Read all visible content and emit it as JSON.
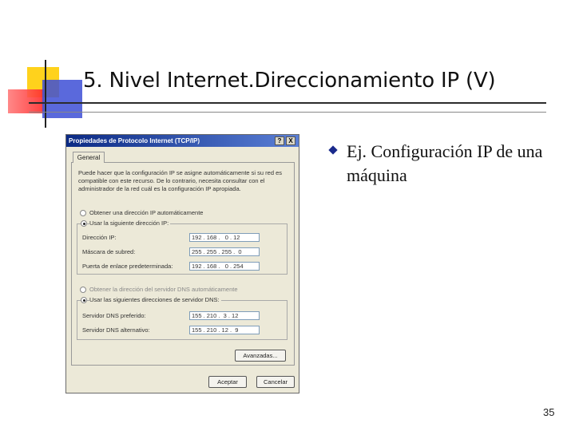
{
  "slide": {
    "title": "5. Nivel Internet.Direccionamiento IP (V)",
    "bullet": "Ej. Configuración IP de una máquina",
    "page_number": "35"
  },
  "dialog": {
    "title": "Propiedades de Protocolo Internet (TCP/IP)",
    "help_label": "?",
    "close_label": "X",
    "tab_label": "General",
    "intro": "Puede hacer que la configuración IP se asigne automáticamente si su red es compatible con este recurso. De lo contrario, necesita consultar con el administrador de la red cuál es la configuración IP apropiada.",
    "auto_ip_label": "Obtener una dirección IP automáticamente",
    "manual_ip_label": "Usar la siguiente dirección IP:",
    "ip_label": "Dirección IP:",
    "ip_value": "192 . 168 .   0 . 12",
    "mask_label": "Máscara de subred:",
    "mask_value": "255 . 255 . 255 .  0",
    "gateway_label": "Puerta de enlace predeterminada:",
    "gateway_value": "192 . 168 .   0 . 254",
    "auto_dns_label": "Obtener la dirección del servidor DNS automáticamente",
    "manual_dns_label": "Usar las siguientes direcciones de servidor DNS:",
    "dns1_label": "Servidor DNS preferido:",
    "dns1_value": "155 . 210 .  3 . 12",
    "dns2_label": "Servidor DNS alternativo:",
    "dns2_value": "155 . 210 . 12 .  9",
    "advanced_label": "Avanzadas...",
    "ok_label": "Aceptar",
    "cancel_label": "Cancelar"
  },
  "colors": {
    "accent_yellow": "#ffd21c",
    "accent_blue": "#3d4fd6",
    "accent_red": "#ff2a2a",
    "titlebar": "#0b2a84",
    "bullet": "#1a2a8c"
  }
}
